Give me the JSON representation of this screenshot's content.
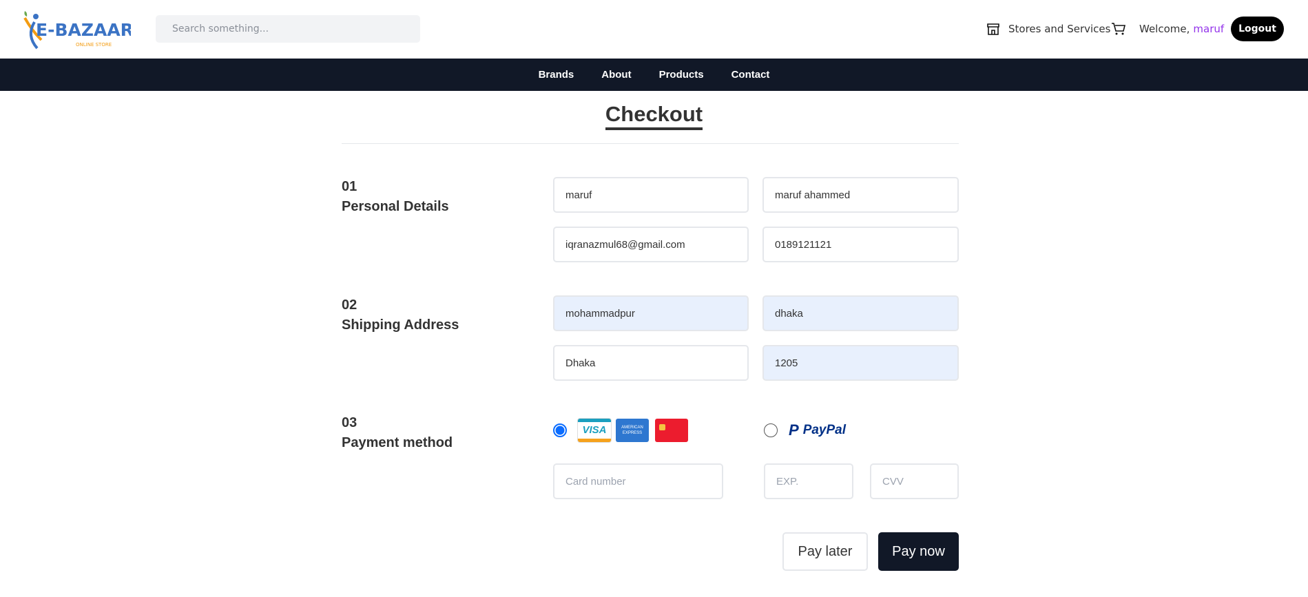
{
  "header": {
    "logo_text": "E-BAZAAR",
    "logo_sub": "ONLINE STORE",
    "search_placeholder": "Search something...",
    "stores_label": "Stores and Services",
    "welcome": "Welcome,",
    "username": "maruf",
    "logout": "Logout"
  },
  "nav": [
    "Brands",
    "About",
    "Products",
    "Contact"
  ],
  "page_title": "Checkout",
  "sections": [
    {
      "num": "01",
      "title": "Personal Details"
    },
    {
      "num": "02",
      "title": "Shipping Address"
    },
    {
      "num": "03",
      "title": "Payment method"
    }
  ],
  "personal": {
    "first_name": "maruf",
    "full_name": "maruf ahammed",
    "email": "iqranazmul68@gmail.com",
    "phone": "0189121121"
  },
  "shipping": {
    "address": "mohammadpur",
    "city": "dhaka",
    "state": "Dhaka",
    "zip": "1205"
  },
  "payment": {
    "selected": "card",
    "visa": "VISA",
    "amex": "AMERICAN EXPRESS",
    "paypal": "PayPal",
    "card_placeholder": "Card number",
    "exp_placeholder": "EXP.",
    "cvv_placeholder": "CVV"
  },
  "buttons": {
    "pay_later": "Pay later",
    "pay_now": "Pay now"
  },
  "colors": {
    "nav_bg": "#111827",
    "accent": "#9333ea",
    "radio": "#0a6cff"
  }
}
